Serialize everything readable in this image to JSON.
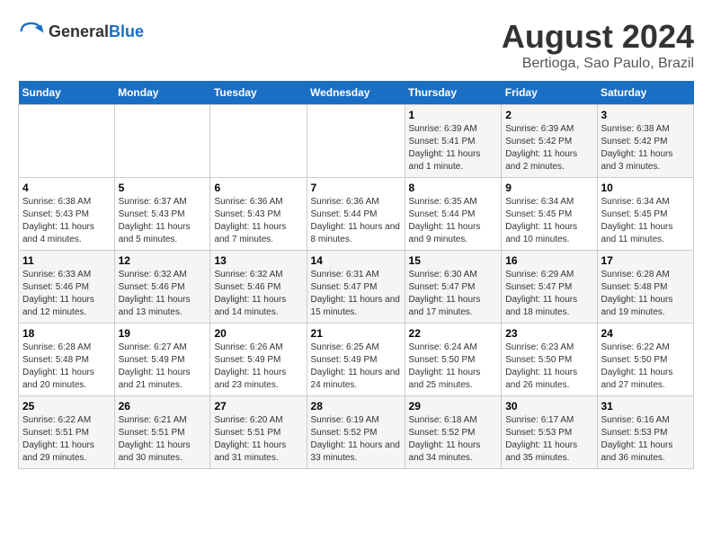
{
  "logo": {
    "text_general": "General",
    "text_blue": "Blue"
  },
  "title": "August 2024",
  "subtitle": "Bertioga, Sao Paulo, Brazil",
  "days_of_week": [
    "Sunday",
    "Monday",
    "Tuesday",
    "Wednesday",
    "Thursday",
    "Friday",
    "Saturday"
  ],
  "weeks": [
    [
      {
        "day": "",
        "info": ""
      },
      {
        "day": "",
        "info": ""
      },
      {
        "day": "",
        "info": ""
      },
      {
        "day": "",
        "info": ""
      },
      {
        "day": "1",
        "info": "Sunrise: 6:39 AM\nSunset: 5:41 PM\nDaylight: 11 hours and 1 minute."
      },
      {
        "day": "2",
        "info": "Sunrise: 6:39 AM\nSunset: 5:42 PM\nDaylight: 11 hours and 2 minutes."
      },
      {
        "day": "3",
        "info": "Sunrise: 6:38 AM\nSunset: 5:42 PM\nDaylight: 11 hours and 3 minutes."
      }
    ],
    [
      {
        "day": "4",
        "info": "Sunrise: 6:38 AM\nSunset: 5:43 PM\nDaylight: 11 hours and 4 minutes."
      },
      {
        "day": "5",
        "info": "Sunrise: 6:37 AM\nSunset: 5:43 PM\nDaylight: 11 hours and 5 minutes."
      },
      {
        "day": "6",
        "info": "Sunrise: 6:36 AM\nSunset: 5:43 PM\nDaylight: 11 hours and 7 minutes."
      },
      {
        "day": "7",
        "info": "Sunrise: 6:36 AM\nSunset: 5:44 PM\nDaylight: 11 hours and 8 minutes."
      },
      {
        "day": "8",
        "info": "Sunrise: 6:35 AM\nSunset: 5:44 PM\nDaylight: 11 hours and 9 minutes."
      },
      {
        "day": "9",
        "info": "Sunrise: 6:34 AM\nSunset: 5:45 PM\nDaylight: 11 hours and 10 minutes."
      },
      {
        "day": "10",
        "info": "Sunrise: 6:34 AM\nSunset: 5:45 PM\nDaylight: 11 hours and 11 minutes."
      }
    ],
    [
      {
        "day": "11",
        "info": "Sunrise: 6:33 AM\nSunset: 5:46 PM\nDaylight: 11 hours and 12 minutes."
      },
      {
        "day": "12",
        "info": "Sunrise: 6:32 AM\nSunset: 5:46 PM\nDaylight: 11 hours and 13 minutes."
      },
      {
        "day": "13",
        "info": "Sunrise: 6:32 AM\nSunset: 5:46 PM\nDaylight: 11 hours and 14 minutes."
      },
      {
        "day": "14",
        "info": "Sunrise: 6:31 AM\nSunset: 5:47 PM\nDaylight: 11 hours and 15 minutes."
      },
      {
        "day": "15",
        "info": "Sunrise: 6:30 AM\nSunset: 5:47 PM\nDaylight: 11 hours and 17 minutes."
      },
      {
        "day": "16",
        "info": "Sunrise: 6:29 AM\nSunset: 5:47 PM\nDaylight: 11 hours and 18 minutes."
      },
      {
        "day": "17",
        "info": "Sunrise: 6:28 AM\nSunset: 5:48 PM\nDaylight: 11 hours and 19 minutes."
      }
    ],
    [
      {
        "day": "18",
        "info": "Sunrise: 6:28 AM\nSunset: 5:48 PM\nDaylight: 11 hours and 20 minutes."
      },
      {
        "day": "19",
        "info": "Sunrise: 6:27 AM\nSunset: 5:49 PM\nDaylight: 11 hours and 21 minutes."
      },
      {
        "day": "20",
        "info": "Sunrise: 6:26 AM\nSunset: 5:49 PM\nDaylight: 11 hours and 23 minutes."
      },
      {
        "day": "21",
        "info": "Sunrise: 6:25 AM\nSunset: 5:49 PM\nDaylight: 11 hours and 24 minutes."
      },
      {
        "day": "22",
        "info": "Sunrise: 6:24 AM\nSunset: 5:50 PM\nDaylight: 11 hours and 25 minutes."
      },
      {
        "day": "23",
        "info": "Sunrise: 6:23 AM\nSunset: 5:50 PM\nDaylight: 11 hours and 26 minutes."
      },
      {
        "day": "24",
        "info": "Sunrise: 6:22 AM\nSunset: 5:50 PM\nDaylight: 11 hours and 27 minutes."
      }
    ],
    [
      {
        "day": "25",
        "info": "Sunrise: 6:22 AM\nSunset: 5:51 PM\nDaylight: 11 hours and 29 minutes."
      },
      {
        "day": "26",
        "info": "Sunrise: 6:21 AM\nSunset: 5:51 PM\nDaylight: 11 hours and 30 minutes."
      },
      {
        "day": "27",
        "info": "Sunrise: 6:20 AM\nSunset: 5:51 PM\nDaylight: 11 hours and 31 minutes."
      },
      {
        "day": "28",
        "info": "Sunrise: 6:19 AM\nSunset: 5:52 PM\nDaylight: 11 hours and 33 minutes."
      },
      {
        "day": "29",
        "info": "Sunrise: 6:18 AM\nSunset: 5:52 PM\nDaylight: 11 hours and 34 minutes."
      },
      {
        "day": "30",
        "info": "Sunrise: 6:17 AM\nSunset: 5:53 PM\nDaylight: 11 hours and 35 minutes."
      },
      {
        "day": "31",
        "info": "Sunrise: 6:16 AM\nSunset: 5:53 PM\nDaylight: 11 hours and 36 minutes."
      }
    ]
  ]
}
